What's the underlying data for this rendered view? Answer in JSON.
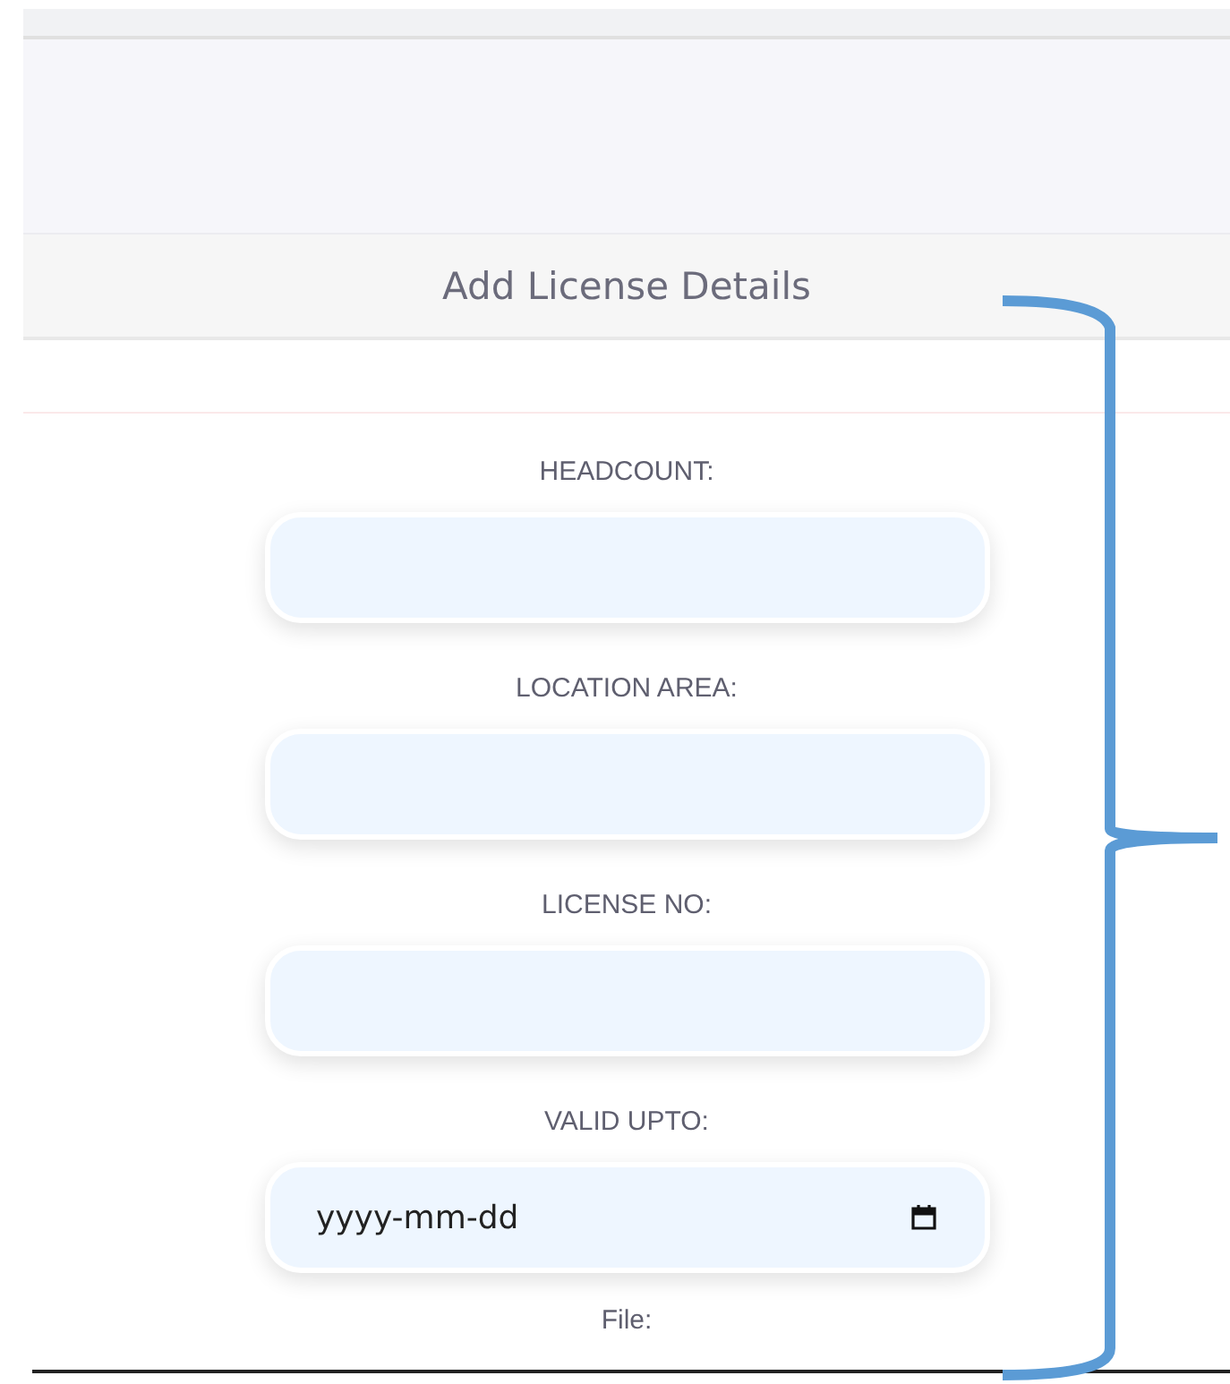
{
  "modal": {
    "title": "Add License Details"
  },
  "fields": [
    {
      "label": "HEADCOUNT:",
      "kind": "text"
    },
    {
      "label": "LOCATION AREA:",
      "kind": "text"
    },
    {
      "label": "LICENSE NO:",
      "kind": "text"
    },
    {
      "label": "VALID UPTO:",
      "kind": "date",
      "placeholder": "yyyy-mm-dd"
    }
  ],
  "file": {
    "label": "File:"
  }
}
